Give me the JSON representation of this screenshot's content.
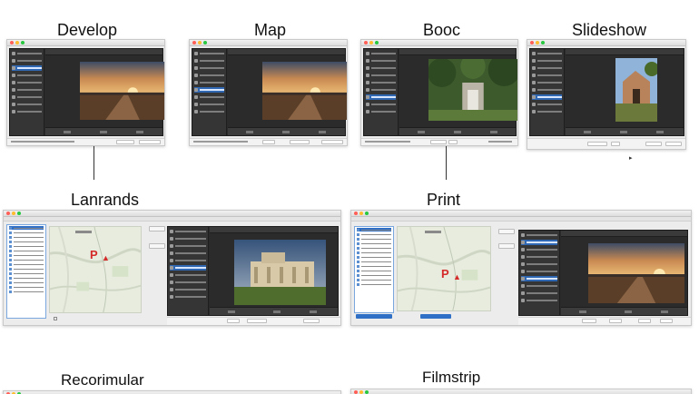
{
  "titles": {
    "develop": "Develop",
    "map": "Map",
    "book": "Booc",
    "slideshow": "Slideshow",
    "landmarks": "Lanrands",
    "print": "Print",
    "recorimular": "Recorimular",
    "filmstrip": "Filmstrip"
  },
  "map_markers": {
    "landmarks_letter": "P",
    "print_letter": "P"
  },
  "icons": {
    "window_close": "close-icon",
    "window_minimize": "minimize-icon",
    "window_zoom": "zoom-icon",
    "map_pin": "map-pin-icon"
  },
  "colors": {
    "selection_blue": "#2f67b3",
    "app_dark": "#2b2b2b",
    "pin_red": "#d42a2a"
  }
}
